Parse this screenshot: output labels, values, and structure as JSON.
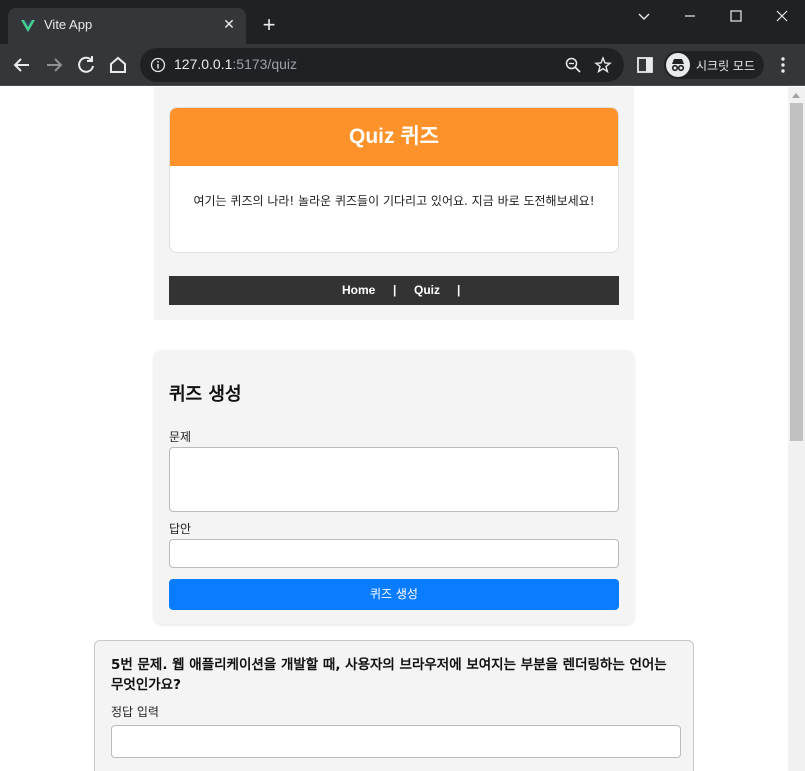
{
  "browser": {
    "tab_title": "Vite App",
    "tab_close": "✕",
    "new_tab": "+",
    "url_host": "127.0.0.1",
    "url_rest": ":5173/quiz",
    "incognito_label": "시크릿 모드"
  },
  "header": {
    "title": "Quiz 퀴즈",
    "description": "여기는 퀴즈의 나라! 놀라운 퀴즈들이 기다리고 있어요. 지금 바로 도전해보세요!",
    "nav": {
      "home": "Home",
      "sep1": "|",
      "quiz": "Quiz",
      "sep2": "|"
    },
    "accent_color": "#fd922a"
  },
  "create_form": {
    "title": "퀴즈 생성",
    "question_label": "문제",
    "question_value": "",
    "answer_label": "답안",
    "answer_value": "",
    "submit_label": "퀴즈 생성",
    "button_color": "#0a7cff"
  },
  "quizzes": [
    {
      "question": "5번 문제. 웹 애플리케이션을 개발할 때, 사용자의 브라우저에 보여지는 부분을 렌더링하는 언어는 무엇인가요?",
      "answer_label": "정답 입력",
      "answer_value": ""
    }
  ]
}
